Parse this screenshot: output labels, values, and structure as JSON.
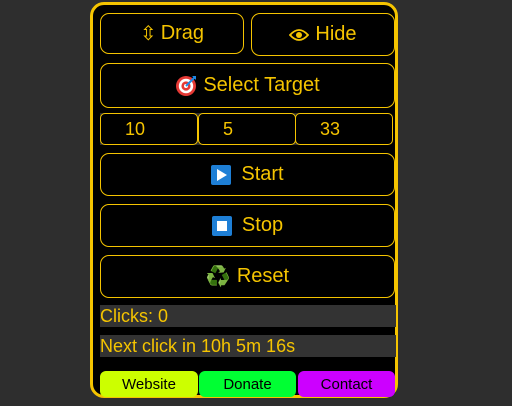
{
  "toolbar": {
    "drag_icon": "⇳",
    "drag_label": "Drag",
    "hide_label": "Hide"
  },
  "target": {
    "label": "Select Target"
  },
  "interval": {
    "hours": "10",
    "minutes": "5",
    "seconds": "33"
  },
  "controls": {
    "start_label": "Start",
    "stop_label": "Stop",
    "reset_label": "Reset",
    "reset_icon": "♻️"
  },
  "status": {
    "clicks_text": "Clicks: 0",
    "next_click_text": "Next click in 10h 5m 16s"
  },
  "links": {
    "website": "Website",
    "donate": "Donate",
    "contact": "Contact"
  },
  "colors": {
    "accent": "#f5c400",
    "website_bg": "#ccff00",
    "donate_bg": "#00ff33",
    "contact_bg": "#cc00ff"
  }
}
